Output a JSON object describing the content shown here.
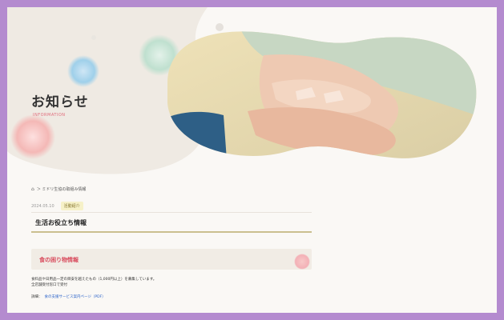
{
  "hero": {
    "title": "お知らせ",
    "subtitle": "INFORMATION"
  },
  "breadcrumb": {
    "home_icon": "home-icon",
    "path": "＞ ミドリ生協の取組み情報"
  },
  "post": {
    "date": "2024.05.10",
    "category": "活動紹介",
    "title": "生活お役立ち情報"
  },
  "section": {
    "title": "食の困り物情報"
  },
  "body": {
    "line1": "食料品や日用品一定の目安を越えたもの（1,000円以上）を募集しています。",
    "line2": "全店舗受付窓口で受付",
    "link_prefix": "詳細：",
    "link_text": "食の支援サービス案内ページ（PDF）"
  },
  "colors": {
    "frame": "#b48bcf",
    "accent_red": "#d8485a",
    "link_blue": "#2a62c9"
  }
}
